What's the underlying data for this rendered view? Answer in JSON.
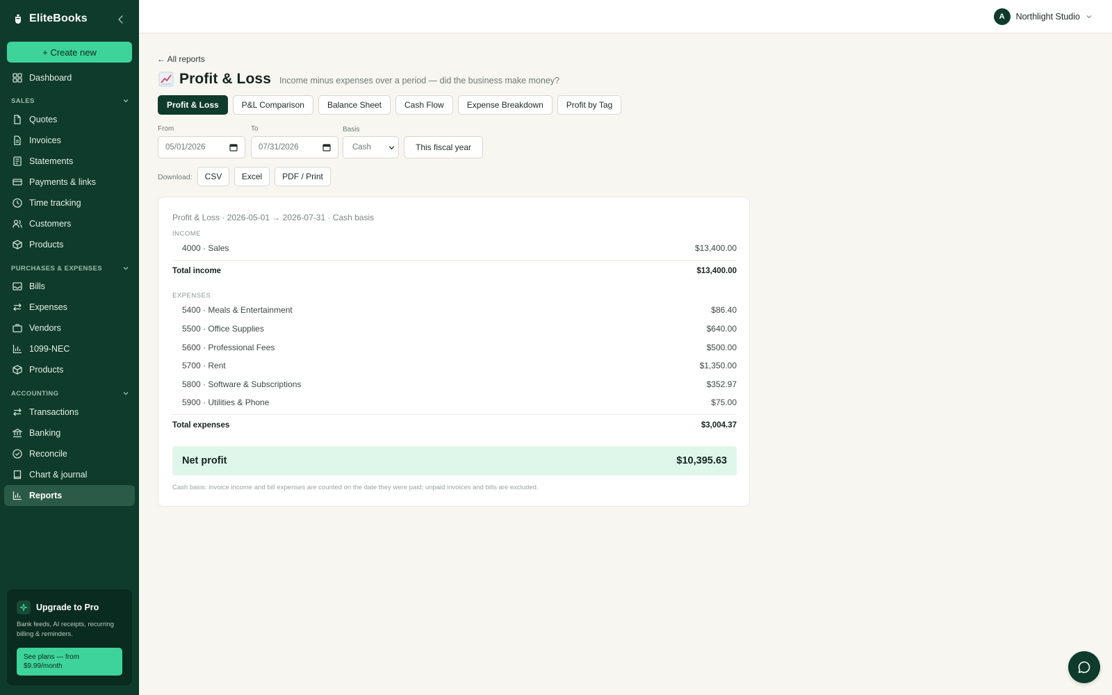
{
  "sidebar": {
    "brand": "EliteBooks",
    "create_label": "+ Create new",
    "dashboard": "Dashboard",
    "sections": {
      "sales": "SALES",
      "purchases": "PURCHASES & EXPENSES",
      "accounting": "ACCOUNTING"
    },
    "sales_items": [
      "Quotes",
      "Invoices",
      "Statements",
      "Payments & links",
      "Time tracking",
      "Customers",
      "Products"
    ],
    "purchases_items": [
      "Bills",
      "Expenses",
      "Vendors",
      "1099-NEC",
      "Products"
    ],
    "accounting_items": [
      "Transactions",
      "Banking",
      "Reconcile",
      "Chart & journal",
      "Reports"
    ],
    "active_item": "Reports",
    "upgrade": {
      "title": "Upgrade to Pro",
      "description": "Bank feeds, AI receipts, recurring billing & reminders.",
      "button": "See plans — from $9.99/month"
    }
  },
  "topbar": {
    "avatar_initial": "A",
    "org_name": "Northlight Studio"
  },
  "main": {
    "back_link": "← All reports",
    "title": "Profit & Loss",
    "subtitle": "Income minus expenses over a period — did the business make money?",
    "tabs": [
      "Profit & Loss",
      "P&L Comparison",
      "Balance Sheet",
      "Cash Flow",
      "Expense Breakdown",
      "Profit by Tag"
    ],
    "active_tab": "Profit & Loss",
    "filters": {
      "from_label": "From",
      "from_value": "05/01/2026",
      "to_label": "To",
      "to_value": "07/31/2026",
      "basis_label": "Basis",
      "basis_value": "Cash",
      "fiscal_button": "This fiscal year"
    },
    "download": {
      "label": "Download:",
      "buttons": [
        "CSV",
        "Excel",
        "PDF / Print"
      ]
    }
  },
  "report": {
    "caption": "Profit & Loss · 2026-05-01 → 2026-07-31 · Cash basis",
    "income_label": "INCOME",
    "income_rows": [
      {
        "name": "4000 · Sales",
        "amount": "$13,400.00"
      }
    ],
    "total_income_label": "Total income",
    "total_income": "$13,400.00",
    "expenses_label": "EXPENSES",
    "expense_rows": [
      {
        "name": "5400 · Meals & Entertainment",
        "amount": "$86.40"
      },
      {
        "name": "5500 · Office Supplies",
        "amount": "$640.00"
      },
      {
        "name": "5600 · Professional Fees",
        "amount": "$500.00"
      },
      {
        "name": "5700 · Rent",
        "amount": "$1,350.00"
      },
      {
        "name": "5800 · Software & Subscriptions",
        "amount": "$352.97"
      },
      {
        "name": "5900 · Utilities & Phone",
        "amount": "$75.00"
      }
    ],
    "total_expenses_label": "Total expenses",
    "total_expenses": "$3,004.37",
    "net_label": "Net profit",
    "net_value": "$10,395.63",
    "footnote": "Cash basis: invoice income and bill expenses are counted on the date they were paid; unpaid invoices and bills are excluded."
  },
  "colors": {
    "sidebar_bg": "#0e3b2b",
    "accent": "#3ed39a",
    "net_bg": "#dff6ea",
    "page_bg": "#f8f6f1"
  }
}
